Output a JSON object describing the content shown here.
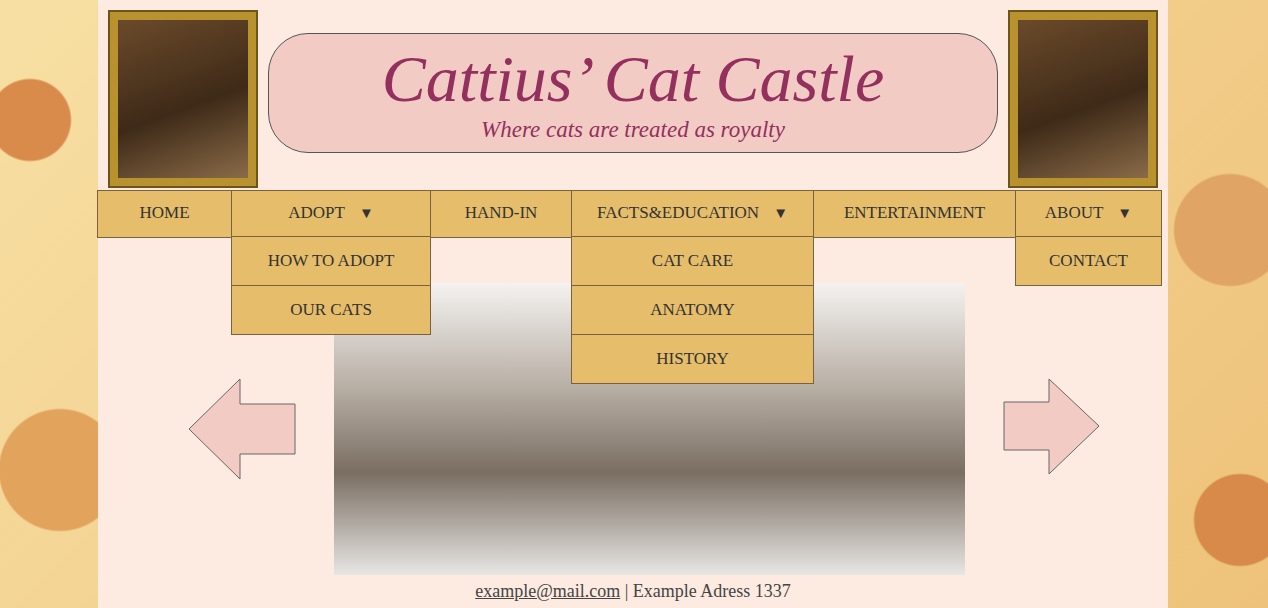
{
  "header": {
    "title": "Cattius’ Cat Castle",
    "subtitle": "Where cats are treated as royalty"
  },
  "nav": [
    {
      "label": "HOME",
      "caret": "",
      "expanded": false,
      "submenu": []
    },
    {
      "label": "ADOPT",
      "caret": "▼",
      "expanded": true,
      "submenu": [
        "HOW TO ADOPT",
        "OUR CATS"
      ]
    },
    {
      "label": "HAND-IN",
      "caret": "",
      "expanded": false,
      "submenu": []
    },
    {
      "label": "FACTS&EDUCATION",
      "caret": "▼",
      "expanded": true,
      "submenu": [
        "CAT CARE",
        "ANATOMY",
        "HISTORY"
      ]
    },
    {
      "label": "ENTERTAINMENT",
      "caret": "",
      "expanded": false,
      "submenu": []
    },
    {
      "label": "ABOUT",
      "caret": "▼",
      "expanded": true,
      "submenu": [
        "CONTACT"
      ]
    }
  ],
  "footer": {
    "email": "example@mail.com",
    "separator": "|",
    "address": "Example Adress 1337"
  }
}
